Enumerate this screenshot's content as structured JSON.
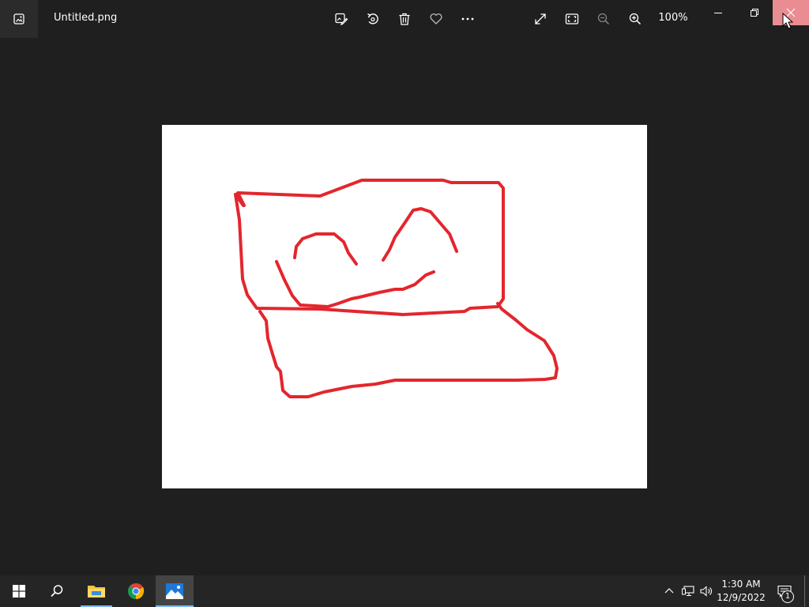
{
  "window": {
    "title": "Untitled.png",
    "zoom": "100%"
  },
  "toolbar": {
    "items": [
      {
        "name": "edit-image",
        "icon": "edit-image-icon",
        "enabled": true
      },
      {
        "name": "rotate",
        "icon": "rotate-icon",
        "enabled": true
      },
      {
        "name": "delete",
        "icon": "trash-icon",
        "enabled": true
      },
      {
        "name": "favorite",
        "icon": "heart-icon",
        "enabled": true
      },
      {
        "name": "more",
        "icon": "ellipsis-icon",
        "enabled": true
      },
      {
        "name": "full-screen",
        "icon": "expand-icon",
        "enabled": true
      },
      {
        "name": "fit-to-window",
        "icon": "fit-window-icon",
        "enabled": true
      },
      {
        "name": "zoom-out",
        "icon": "zoom-out-icon",
        "enabled": false
      },
      {
        "name": "zoom-in",
        "icon": "zoom-in-icon",
        "enabled": true
      }
    ]
  },
  "window_controls": {
    "minimize": "minimize-icon",
    "restore": "restore-icon",
    "close": "close-icon"
  },
  "image": {
    "background": "#ffffff",
    "stroke_color": "#e3262d"
  },
  "taskbar": {
    "apps": [
      {
        "name": "start",
        "icon": "windows-logo-icon"
      },
      {
        "name": "search",
        "icon": "search-icon"
      },
      {
        "name": "file-explorer",
        "icon": "folder-icon"
      },
      {
        "name": "chrome",
        "icon": "chrome-icon"
      },
      {
        "name": "photos",
        "icon": "photos-icon",
        "active": true
      }
    ],
    "tray": {
      "icons": [
        "chevron-up-icon",
        "network-icon",
        "volume-icon"
      ],
      "time": "1:30 AM",
      "date": "12/9/2022",
      "notification_count": "1"
    }
  },
  "colors": {
    "background": "#1f1f1f",
    "taskbar": "#252525",
    "close_hover": "#ea8d92",
    "active_underline": "#7eb6ff"
  }
}
